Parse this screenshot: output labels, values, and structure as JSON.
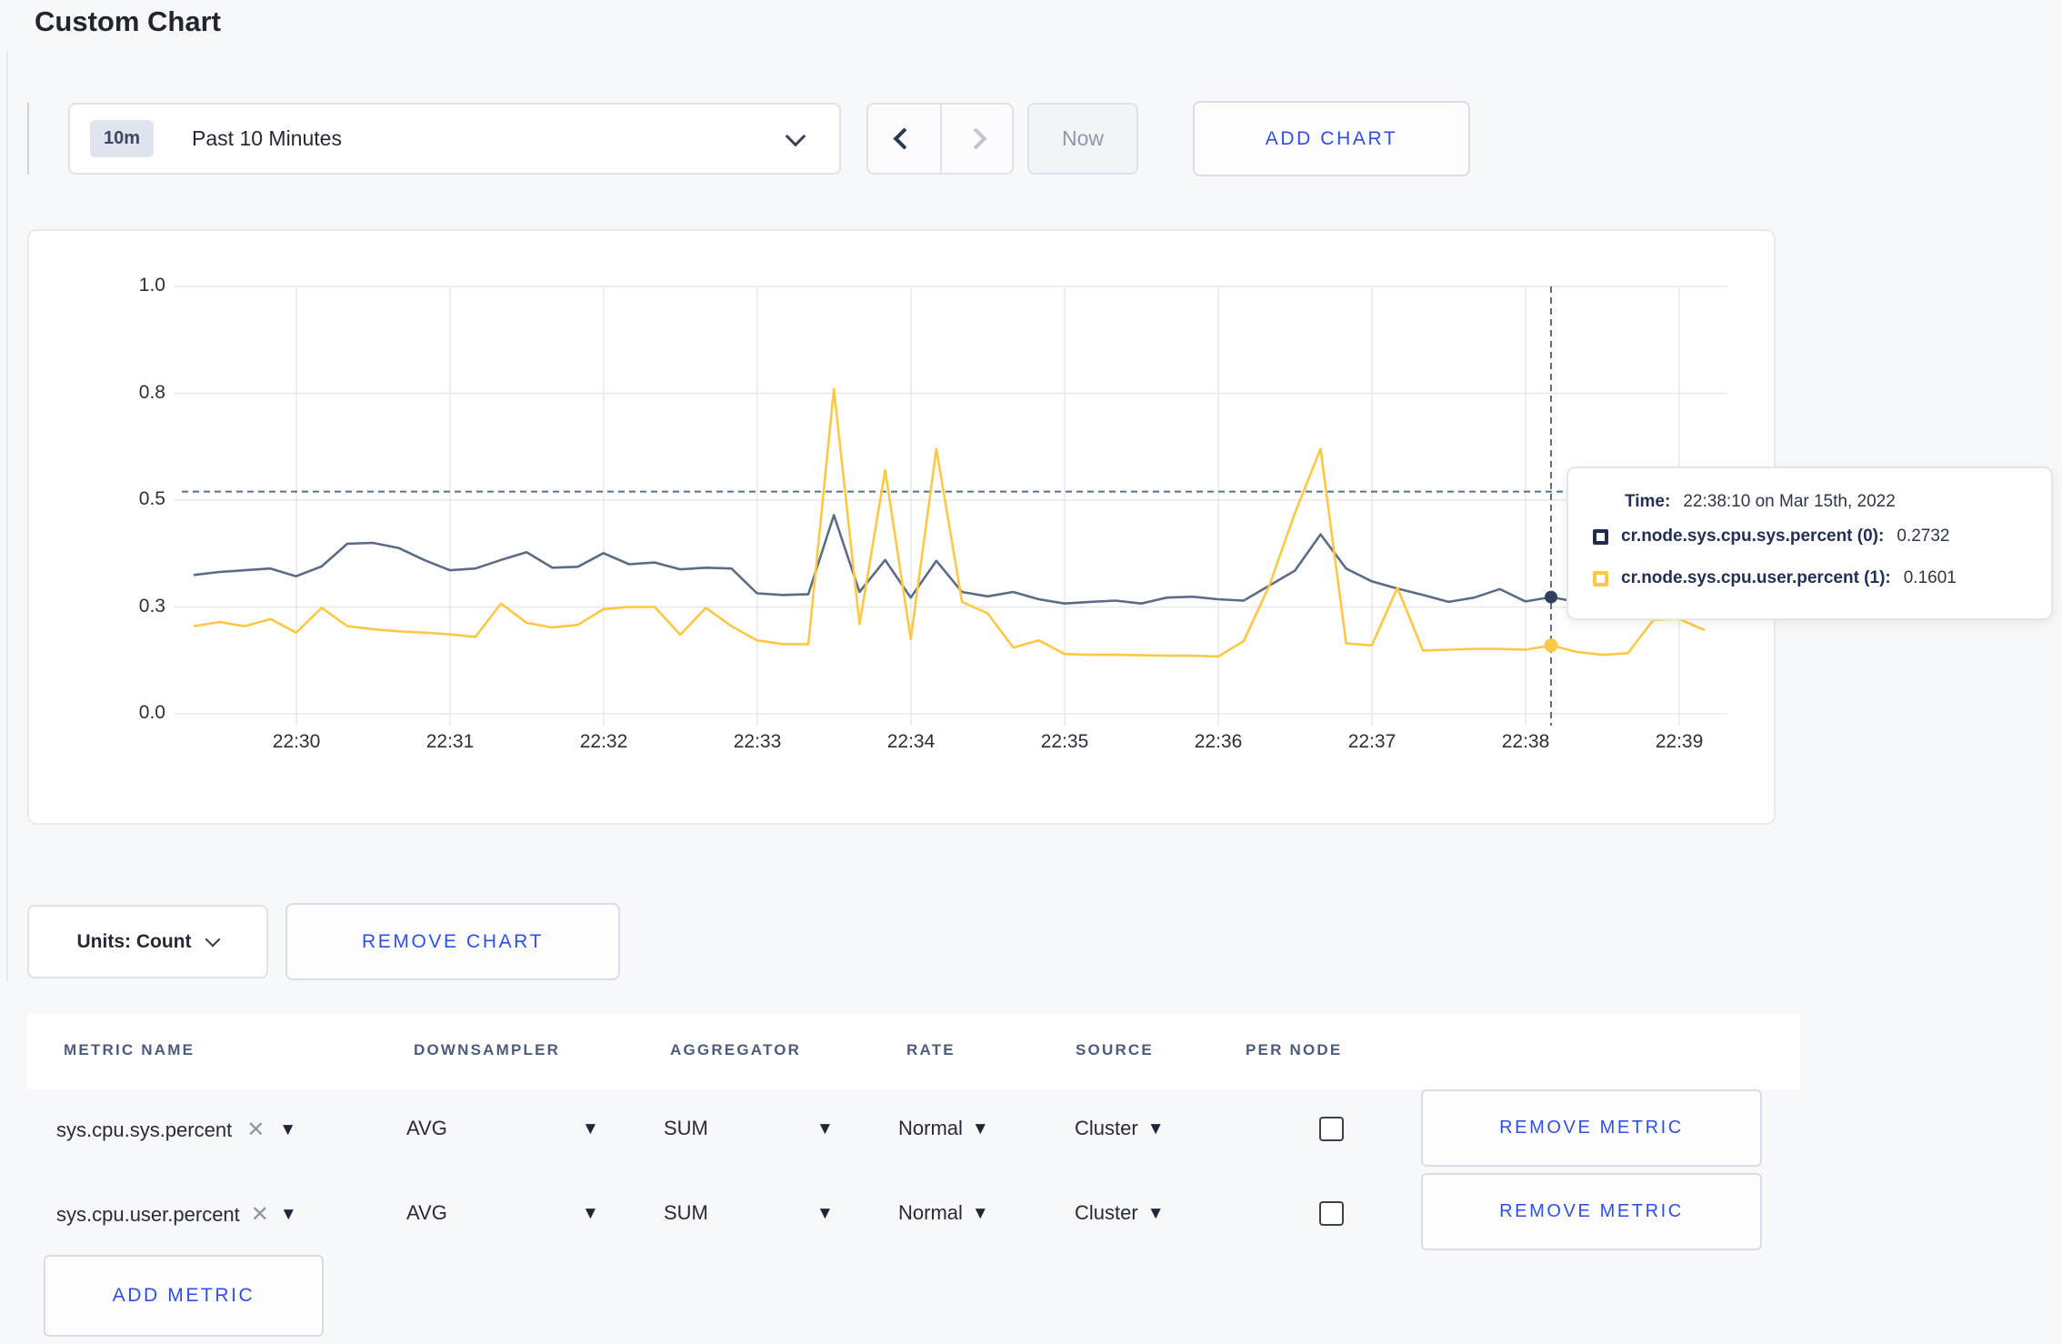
{
  "page": {
    "title": "Custom Chart",
    "background": "#f7f8fa",
    "accent_blue": "#2e4fe6"
  },
  "toolbar": {
    "time_badge": "10m",
    "time_label": "Past 10 Minutes",
    "now_label": "Now",
    "add_chart_label": "ADD CHART"
  },
  "chart_data": {
    "type": "line",
    "title": "",
    "xlabel": "",
    "ylabel": "",
    "ylim": [
      0,
      1
    ],
    "grid": true,
    "legend_position": "tooltip",
    "x_tick_labels": [
      "22:30",
      "22:31",
      "22:32",
      "22:33",
      "22:34",
      "22:35",
      "22:36",
      "22:37",
      "22:38",
      "22:39"
    ],
    "y_tick_labels": [
      "0.0",
      "0.3",
      "0.5",
      "0.8",
      "1.0"
    ],
    "y_tick_values": [
      0,
      0.25,
      0.5,
      0.75,
      1.0
    ],
    "x_start_time": "22:29:20",
    "x_step_seconds": 10,
    "series": [
      {
        "name": "cr.node.sys.cpu.sys.percent",
        "color": "#5c6b86",
        "values": [
          0.325,
          0.332,
          0.336,
          0.34,
          0.322,
          0.345,
          0.398,
          0.4,
          0.388,
          0.36,
          0.336,
          0.34,
          0.36,
          0.378,
          0.342,
          0.344,
          0.376,
          0.35,
          0.354,
          0.338,
          0.342,
          0.34,
          0.282,
          0.278,
          0.28,
          0.465,
          0.285,
          0.36,
          0.272,
          0.358,
          0.285,
          0.275,
          0.285,
          0.268,
          0.258,
          0.262,
          0.265,
          0.258,
          0.272,
          0.274,
          0.268,
          0.265,
          0.3,
          0.335,
          0.42,
          0.34,
          0.31,
          0.293,
          0.278,
          0.262,
          0.272,
          0.292,
          0.263,
          0.2732,
          0.262,
          0.268,
          0.272,
          0.27,
          0.273,
          0.268
        ]
      },
      {
        "name": "cr.node.sys.cpu.user.percent",
        "color": "#ffc843",
        "values": [
          0.205,
          0.215,
          0.205,
          0.222,
          0.19,
          0.248,
          0.205,
          0.198,
          0.193,
          0.19,
          0.186,
          0.18,
          0.258,
          0.213,
          0.202,
          0.208,
          0.245,
          0.25,
          0.25,
          0.185,
          0.248,
          0.205,
          0.172,
          0.163,
          0.163,
          0.76,
          0.21,
          0.57,
          0.175,
          0.62,
          0.262,
          0.235,
          0.155,
          0.172,
          0.14,
          0.138,
          0.138,
          0.137,
          0.136,
          0.136,
          0.134,
          0.17,
          0.3,
          0.47,
          0.62,
          0.165,
          0.16,
          0.295,
          0.148,
          0.15,
          0.152,
          0.152,
          0.15,
          0.1601,
          0.145,
          0.138,
          0.142,
          0.22,
          0.222,
          0.196
        ]
      }
    ],
    "crosshair": {
      "index": 53,
      "time": "22:38:10 on Mar 15th, 2022",
      "hline_value": 0.52,
      "points": [
        {
          "series": "cr.node.sys.cpu.sys.percent",
          "value": 0.2732
        },
        {
          "series": "cr.node.sys.cpu.user.percent",
          "value": 0.1601
        }
      ]
    }
  },
  "tooltip": {
    "time_label": "Time:",
    "time_value": "22:38:10 on Mar 15th, 2022",
    "rows": [
      {
        "label": "cr.node.sys.cpu.sys.percent (0):",
        "value": "0.2732",
        "swatch": "#1d2c4f"
      },
      {
        "label": "cr.node.sys.cpu.user.percent (1):",
        "value": "0.1601",
        "swatch": "#ffc843"
      }
    ]
  },
  "chart_footer": {
    "units_label": "Units: Count",
    "remove_chart_label": "REMOVE CHART"
  },
  "metrics_table": {
    "headers": [
      "METRIC NAME",
      "DOWNSAMPLER",
      "AGGREGATOR",
      "RATE",
      "SOURCE",
      "PER NODE"
    ],
    "rows": [
      {
        "metric": "sys.cpu.sys.percent",
        "downsampler": "AVG",
        "aggregator": "SUM",
        "rate": "Normal",
        "source": "Cluster",
        "per_node": false,
        "remove_label": "REMOVE METRIC"
      },
      {
        "metric": "sys.cpu.user.percent",
        "downsampler": "AVG",
        "aggregator": "SUM",
        "rate": "Normal",
        "source": "Cluster",
        "per_node": false,
        "remove_label": "REMOVE METRIC"
      }
    ],
    "add_metric_label": "ADD METRIC"
  }
}
